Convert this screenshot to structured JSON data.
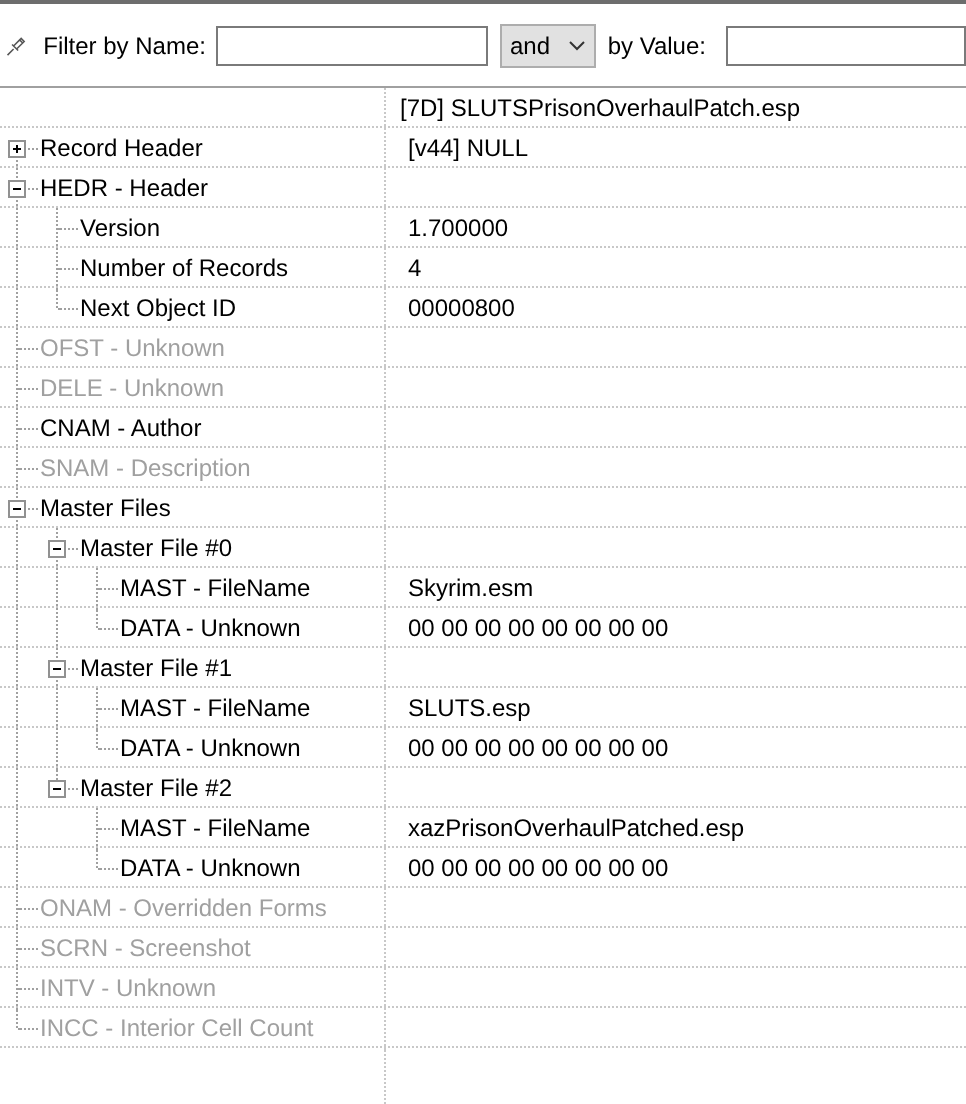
{
  "filter_bar": {
    "name_label": "Filter by Name:",
    "operator": "and",
    "value_label": "by Value:"
  },
  "tree": {
    "value_heading": "[7D] SLUTSPrisonOverhaulPatch.esp",
    "rows": [
      {
        "name": "Record Header",
        "value": "[v44] NULL",
        "disabled": false,
        "expanded": false
      },
      {
        "name": "HEDR - Header",
        "disabled": false,
        "expanded": true,
        "children": [
          {
            "name": "Version",
            "value": "1.700000",
            "disabled": false
          },
          {
            "name": "Number of Records",
            "value": "4",
            "disabled": false
          },
          {
            "name": "Next Object ID",
            "value": "00000800",
            "disabled": false
          }
        ]
      },
      {
        "name": "OFST - Unknown",
        "disabled": true
      },
      {
        "name": "DELE - Unknown",
        "disabled": true
      },
      {
        "name": "CNAM - Author",
        "disabled": false
      },
      {
        "name": "SNAM - Description",
        "disabled": true
      },
      {
        "name": "Master Files",
        "disabled": false,
        "expanded": true,
        "children": [
          {
            "name": "Master File #0",
            "disabled": false,
            "expanded": true,
            "children": [
              {
                "name": "MAST - FileName",
                "value": "Skyrim.esm",
                "disabled": false
              },
              {
                "name": "DATA - Unknown",
                "value": "00 00 00 00 00 00 00 00",
                "disabled": false
              }
            ]
          },
          {
            "name": "Master File #1",
            "disabled": false,
            "expanded": true,
            "children": [
              {
                "name": "MAST - FileName",
                "value": "SLUTS.esp",
                "disabled": false
              },
              {
                "name": "DATA - Unknown",
                "value": "00 00 00 00 00 00 00 00",
                "disabled": false
              }
            ]
          },
          {
            "name": "Master File #2",
            "disabled": false,
            "expanded": true,
            "children": [
              {
                "name": "MAST - FileName",
                "value": "xazPrisonOverhaulPatched.esp",
                "disabled": false
              },
              {
                "name": "DATA - Unknown",
                "value": "00 00 00 00 00 00 00 00",
                "disabled": false
              }
            ]
          }
        ]
      },
      {
        "name": "ONAM - Overridden Forms",
        "disabled": true
      },
      {
        "name": "SCRN - Screenshot",
        "disabled": true
      },
      {
        "name": "INTV - Unknown",
        "disabled": true
      },
      {
        "name": "INCC - Interior Cell Count",
        "disabled": true
      }
    ]
  }
}
